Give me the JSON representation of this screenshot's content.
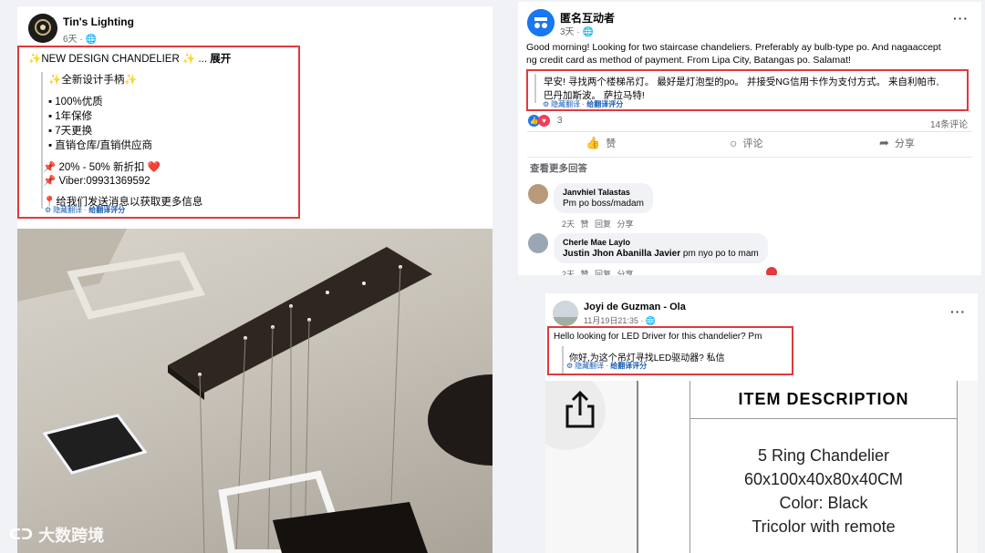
{
  "post1": {
    "author": "Tin's Lighting",
    "time": "6天 · ",
    "headline": "✨NEW DESIGN CHANDELIER ✨ ... ",
    "expand": "展开",
    "subheadline": "✨全新设计手柄✨",
    "bullets": [
      "100%优质",
      "1年保修",
      "7天更换",
      "直销仓库/直销供应商"
    ],
    "discount": "📌 20% - 50% 新折扣 ❤️",
    "viber": "📌 Viber:09931369592",
    "cta": "📍给我们发送消息以获取更多信息",
    "translate_hide": "隐藏翻译",
    "translate_rate": "给翻译评分"
  },
  "post2": {
    "author": "匿名互动者",
    "time": "3天 · ",
    "body_line1": "Good morning! Looking for two staircase chandeliers. Preferably ay bulb-type po. And nagaaccept",
    "body_line2": "ng credit card as method of payment. From Lipa City, Batangas po. Salamat!",
    "translation_line1": "早安! 寻找两个楼梯吊灯。 最好是灯泡型的po。 并接受NG信用卡作为支付方式。 来自利帕市,",
    "translation_line2": "巴丹加斯波。 萨拉马特!",
    "translate_hide": "隐藏翻译",
    "translate_rate": "给翻译评分",
    "reaction_count": "3",
    "comment_count": "14条评论",
    "like_label": "赞",
    "comment_label": "评论",
    "share_label": "分享",
    "more_comments": "查看更多回答",
    "comments": [
      {
        "name": "Janvhiel Talastas",
        "text": "Pm po boss/madam",
        "meta": "2天 赞 回复 分享"
      },
      {
        "name": "Cherle Mae Laylo",
        "text_bold": "Justin Jhon Abanilla Javier",
        "text": " pm nyo po to mam",
        "meta": "2天 赞 回复 分享"
      }
    ]
  },
  "post3": {
    "author": "Joyi de Guzman - Ola",
    "time": "11月19日21:35 · ",
    "body": "Hello looking for LED Driver for this chandelier? Pm",
    "translation": "你好,为这个吊灯寻找LED驱动器? 私信",
    "translate_hide": "隐藏翻译",
    "translate_rate": "给翻译评分"
  },
  "item_card": {
    "heading": "ITEM DESCRIPTION",
    "lines": [
      "5 Ring Chandelier",
      "60x100x40x80x40CM",
      "Color: Black",
      "Tricolor with remote"
    ]
  },
  "watermark": "大数跨境",
  "colors": {
    "highlight": "#e0393e",
    "link": "#1a5fb4",
    "muted": "#65676b"
  }
}
